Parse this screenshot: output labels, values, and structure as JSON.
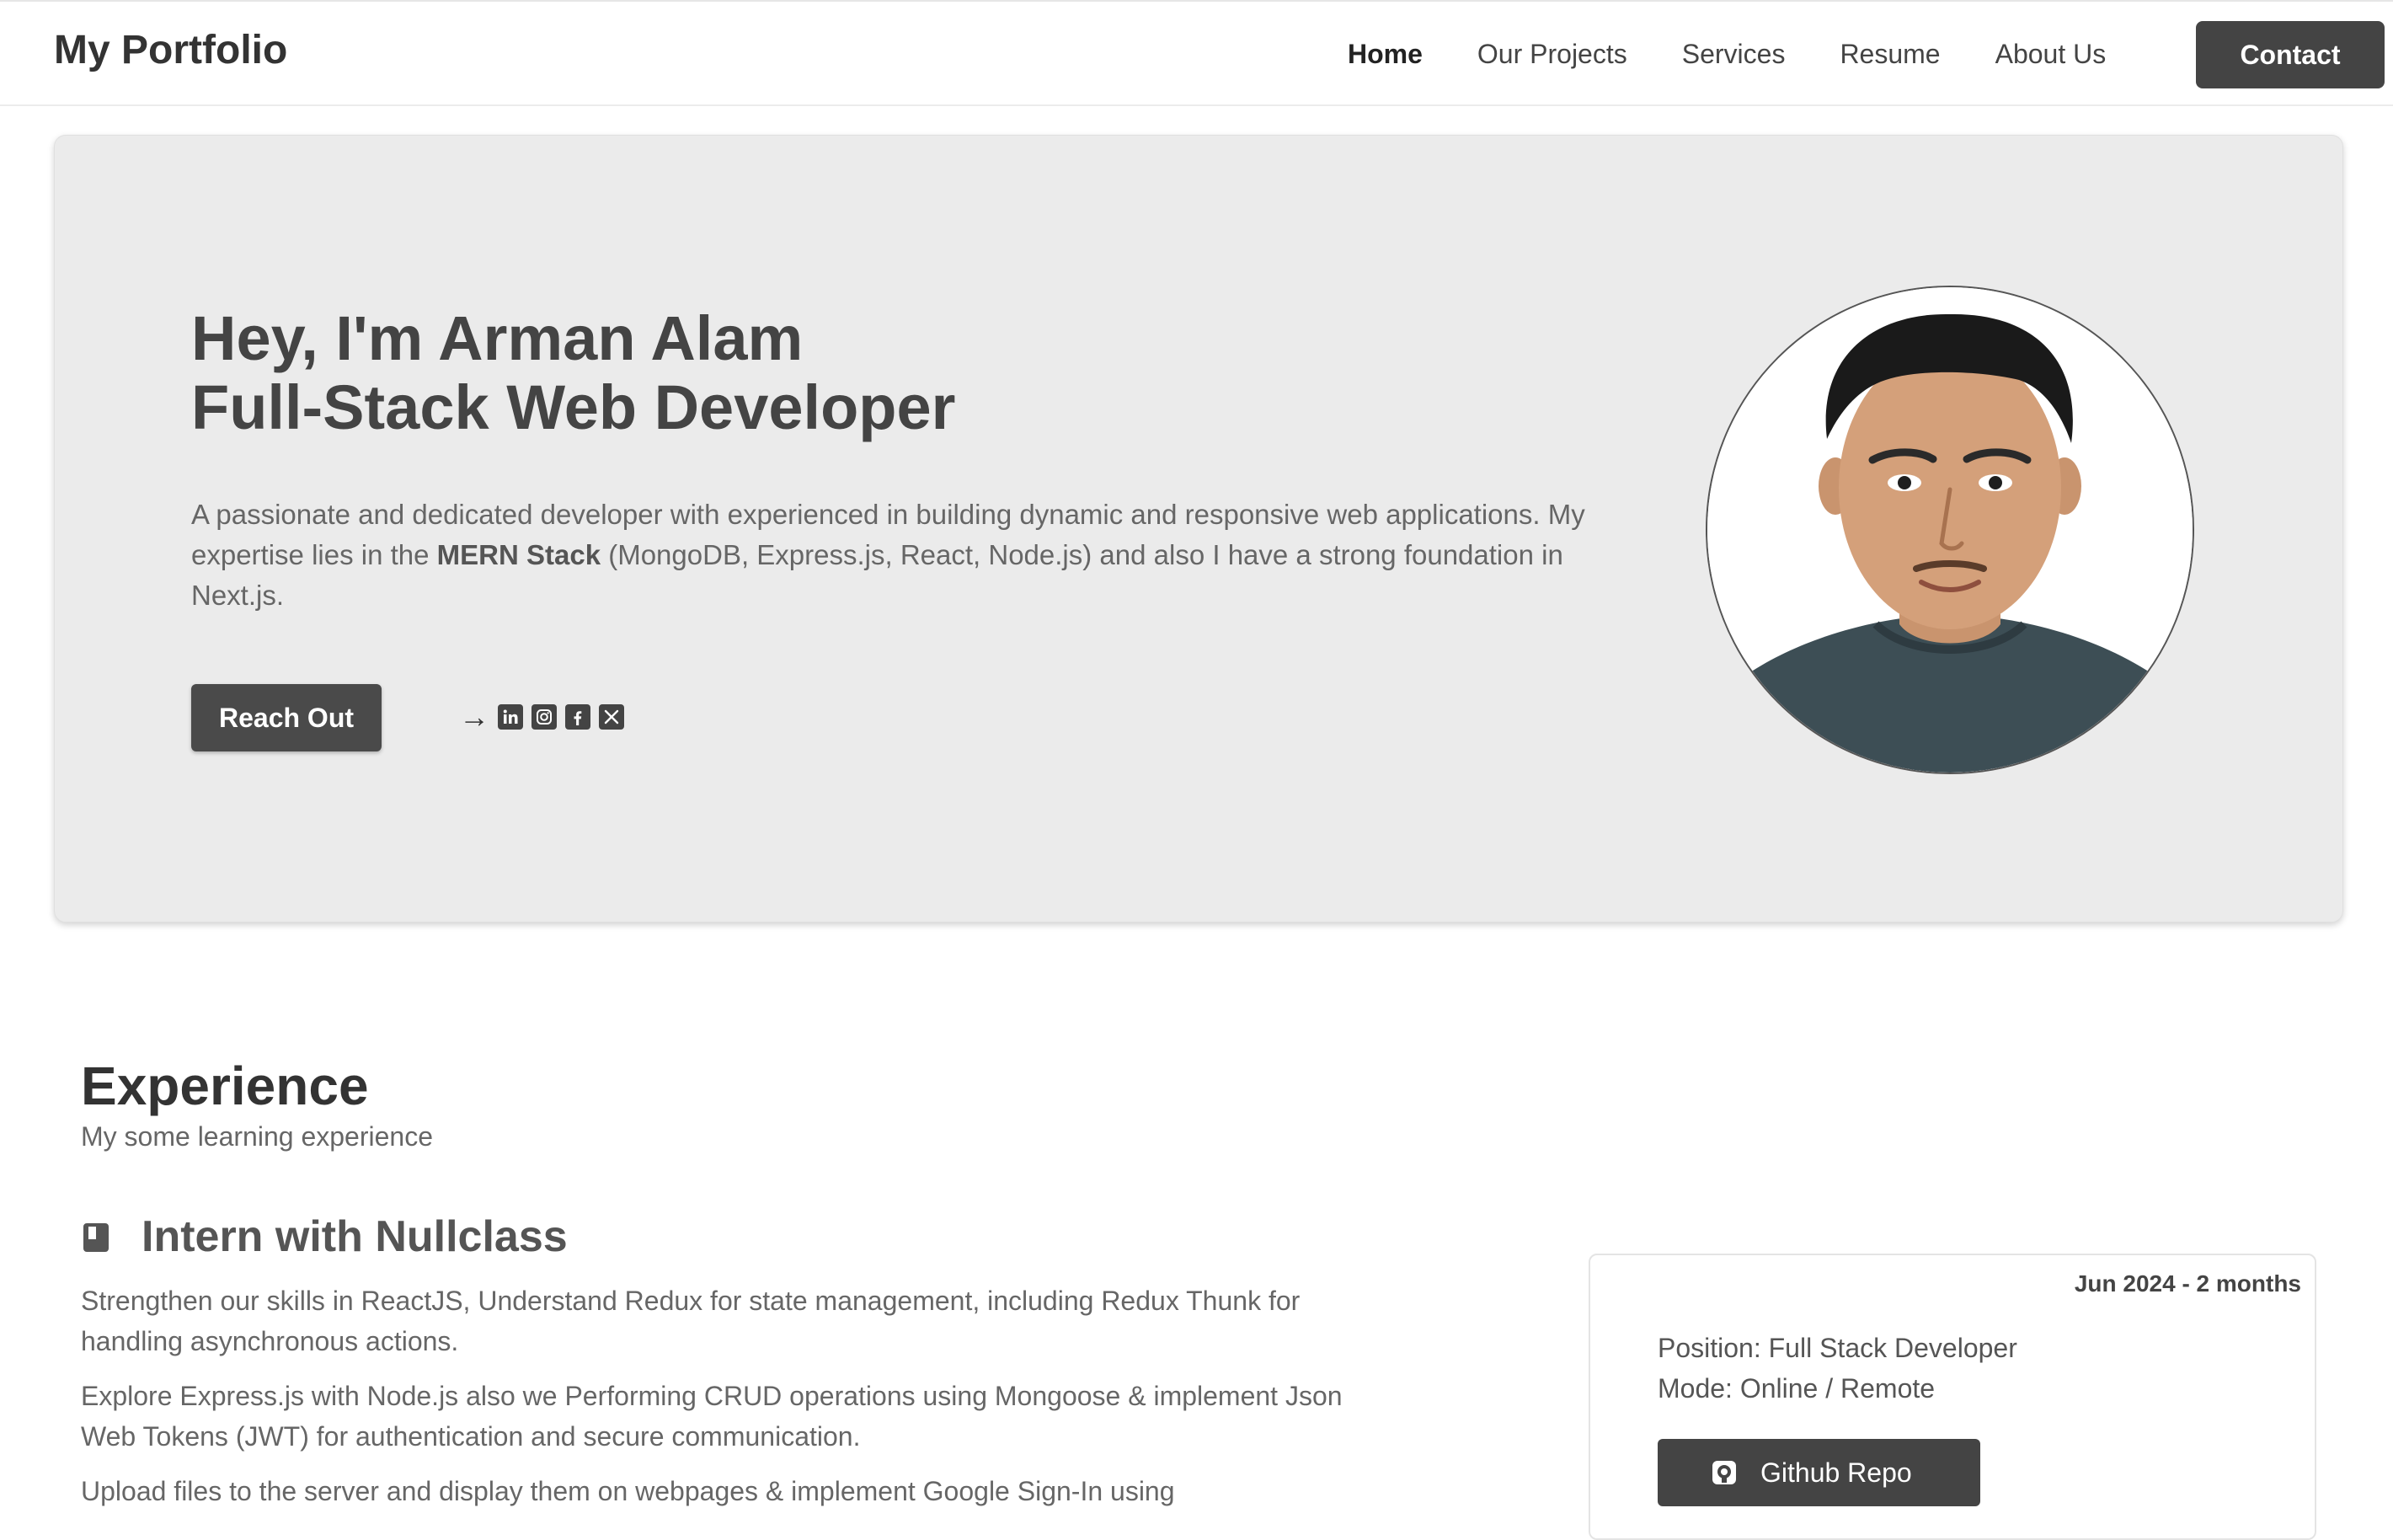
{
  "navbar": {
    "brand": "My Portfolio",
    "links": [
      {
        "label": "Home",
        "active": true
      },
      {
        "label": "Our Projects"
      },
      {
        "label": "Services"
      },
      {
        "label": "Resume"
      },
      {
        "label": "About Us"
      }
    ],
    "contact_label": "Contact"
  },
  "hero": {
    "title_line1": "Hey, I'm Arman Alam",
    "title_line2": "Full-Stack Web Developer",
    "desc_before": "A passionate and dedicated developer with experienced in building dynamic and responsive web applications. My expertise lies in the ",
    "desc_bold": "MERN Stack",
    "desc_after": " (MongoDB, Express.js, React, Node.js) and also I have a strong foundation in Next.js.",
    "reach_label": "Reach Out",
    "arrow": "→",
    "socials": [
      "linkedin-icon",
      "instagram-icon",
      "facebook-icon",
      "x-icon"
    ]
  },
  "experience": {
    "heading": "Experience",
    "subtitle": "My some learning experience",
    "job": {
      "title": "Intern with Nullclass",
      "points": [
        "Strengthen our skills in ReactJS, Understand Redux for state management, including Redux Thunk for handling asynchronous actions.",
        "Explore Express.js with Node.js also we Performing CRUD operations using Mongoose & implement Json Web Tokens (JWT) for authentication and secure communication.",
        "Upload files to the server and display them on webpages & implement Google Sign-In using"
      ],
      "date": "Jun 2024 - 2 months",
      "position": "Position: Full Stack Developer",
      "mode": "Mode: Online / Remote",
      "repo_label": "Github Repo"
    }
  }
}
